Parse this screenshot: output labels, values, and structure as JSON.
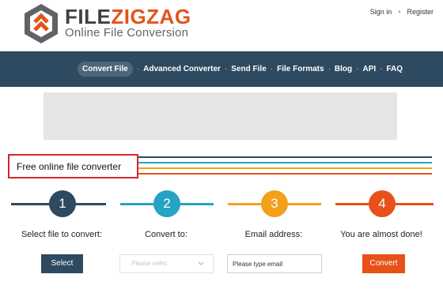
{
  "header": {
    "brand_prefix": "FILE",
    "brand_suffix": "ZIGZAG",
    "tagline": "Online File Conversion",
    "sign_in": "Sign in",
    "register": "Register"
  },
  "nav": {
    "items": [
      {
        "label": "Convert File",
        "active": true
      },
      {
        "label": "Advanced Converter"
      },
      {
        "label": "Send File"
      },
      {
        "label": "File Formats"
      },
      {
        "label": "Blog"
      },
      {
        "label": "API"
      },
      {
        "label": "FAQ"
      }
    ]
  },
  "section": {
    "title": "Free online file converter"
  },
  "steps": [
    {
      "number": "1",
      "label": "Select file to convert:",
      "color": "#2e4a60"
    },
    {
      "number": "2",
      "label": "Convert to:",
      "color": "#27a3c3"
    },
    {
      "number": "3",
      "label": "Email address:",
      "color": "#f3a01d"
    },
    {
      "number": "4",
      "label": "You are almost done!",
      "color": "#e8501a"
    }
  ],
  "controls": {
    "select_label": "Select",
    "format_placeholder": "Please selec",
    "email_placeholder": "Please type email",
    "convert_label": "Convert"
  },
  "colors": {
    "nav_bg": "#2e4a60",
    "brand_orange": "#e2541b",
    "title_border": "#d4252c"
  }
}
